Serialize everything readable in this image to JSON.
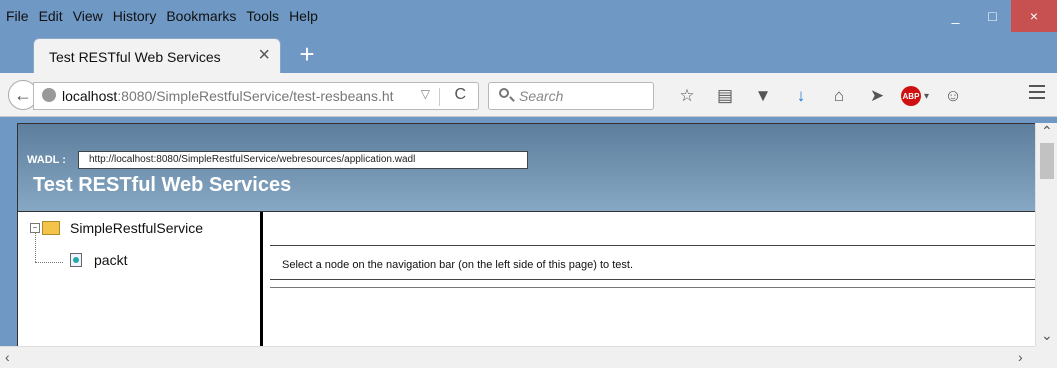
{
  "menu": [
    "File",
    "Edit",
    "View",
    "History",
    "Bookmarks",
    "Tools",
    "Help"
  ],
  "window_controls": {
    "minimize": "_",
    "maximize": "□",
    "close": "×"
  },
  "tab": {
    "title": "Test RESTful Web Services",
    "close": "×",
    "new_tab": "+"
  },
  "address": {
    "host": "localhost",
    "rest": ":8080/SimpleRestfulService/test-resbeans.ht",
    "dropdown": "▽",
    "reload": "C"
  },
  "search": {
    "placeholder": "Search"
  },
  "toolbar_icons": [
    "star-icon",
    "reading-list-icon",
    "pocket-icon",
    "download-icon",
    "home-icon",
    "send-icon",
    "adblock-icon",
    "chat-icon",
    "menu-icon"
  ],
  "page": {
    "wadl_label": "WADL :",
    "wadl_url": "http://localhost:8080/SimpleRestfulService/webresources/application.wadl",
    "title": "Test RESTful Web Services",
    "tree": {
      "root": "SimpleRestfulService",
      "child": "packt"
    },
    "message": "Select a node on the navigation bar (on the left side of this page) to test."
  },
  "abp_text": "ABP",
  "colors": {
    "chrome": "#6f98c4",
    "header_top": "#5d7e9c",
    "header_bottom": "#86a8c4",
    "close_red": "#c75050"
  }
}
